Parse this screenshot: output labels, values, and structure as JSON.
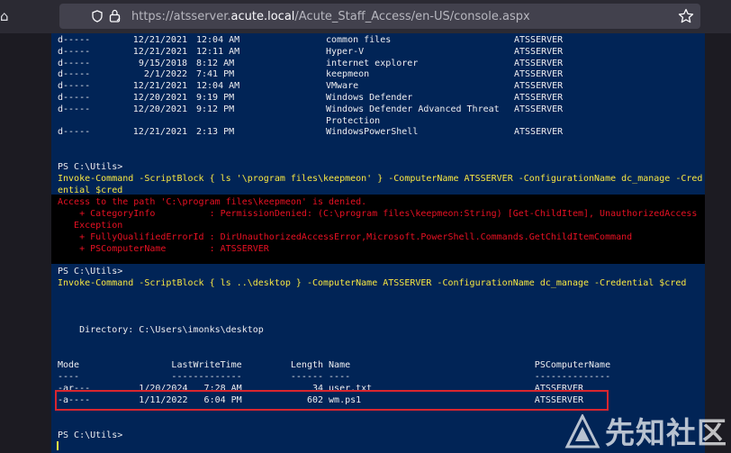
{
  "browser": {
    "url_prefix": "https://atsserver.",
    "url_host": "acute.local",
    "url_path": "/Acute_Staff_Access/en-US/console.aspx"
  },
  "terminal": {
    "dir_listing_top": [
      {
        "mode": "d-----",
        "date": "12/21/2021",
        "time": "12:04 AM",
        "name": "common files",
        "computer": "ATSSERVER"
      },
      {
        "mode": "d-----",
        "date": "12/21/2021",
        "time": "12:11 AM",
        "name": "Hyper-V",
        "computer": "ATSSERVER"
      },
      {
        "mode": "d-----",
        "date": "9/15/2018",
        "time": "8:12 AM",
        "name": "internet explorer",
        "computer": "ATSSERVER"
      },
      {
        "mode": "d-----",
        "date": "2/1/2022",
        "time": "7:41 PM",
        "name": "keepmeon",
        "computer": "ATSSERVER"
      },
      {
        "mode": "d-----",
        "date": "12/21/2021",
        "time": "12:04 AM",
        "name": "VMware",
        "computer": "ATSSERVER"
      },
      {
        "mode": "d-----",
        "date": "12/20/2021",
        "time": "9:19 PM",
        "name": "Windows Defender",
        "computer": "ATSSERVER"
      },
      {
        "mode": "d-----",
        "date": "12/20/2021",
        "time": "9:12 PM",
        "name": "Windows Defender Advanced Threat",
        "computer": "ATSSERVER"
      },
      {
        "mode": "",
        "date": "",
        "time": "",
        "name": "Protection",
        "computer": ""
      },
      {
        "mode": "d-----",
        "date": "12/21/2021",
        "time": "2:13 PM",
        "name": "WindowsPowerShell",
        "computer": "ATSSERVER"
      }
    ],
    "prompt": "PS C:\\Utils>",
    "cmd1_line1": "Invoke-Command -ScriptBlock { ls '\\program files\\keepmeon' } -ComputerName ATSSERVER -ConfigurationName dc_manage -Cred",
    "cmd1_line2": "ential $cred",
    "error_lines": [
      "Access to the path 'C:\\program files\\keepmeon' is denied.",
      "    + CategoryInfo          : PermissionDenied: (C:\\program files\\keepmeon:String) [Get-ChildItem], UnauthorizedAccess",
      "   Exception",
      "    + FullyQualifiedErrorId : DirUnauthorizedAccessError,Microsoft.PowerShell.Commands.GetChildItemCommand",
      "    + PSComputerName        : ATSSERVER"
    ],
    "cmd2": "Invoke-Command -ScriptBlock { ls ..\\desktop } -ComputerName ATSSERVER -ConfigurationName dc_manage -Credential $cred",
    "directory_line": "    Directory: C:\\Users\\imonks\\desktop",
    "header_line": "Mode                 LastWriteTime         Length Name                                  PSComputerName",
    "underline_line": "----                 -------------         ------ ----                                  --------------",
    "desktop_rows": [
      "-ar---         1/20/2024   7:28 AM             34 user.txt                              ATSSERVER",
      "-a----         1/11/2022   6:04 PM            602 wm.ps1                                ATSSERVER"
    ]
  },
  "watermark": {
    "text": "先知社区"
  },
  "colors": {
    "terminal_bg": "#012456",
    "command": "#f8e642",
    "error": "#e81123",
    "highlight_box": "#d9262f"
  }
}
